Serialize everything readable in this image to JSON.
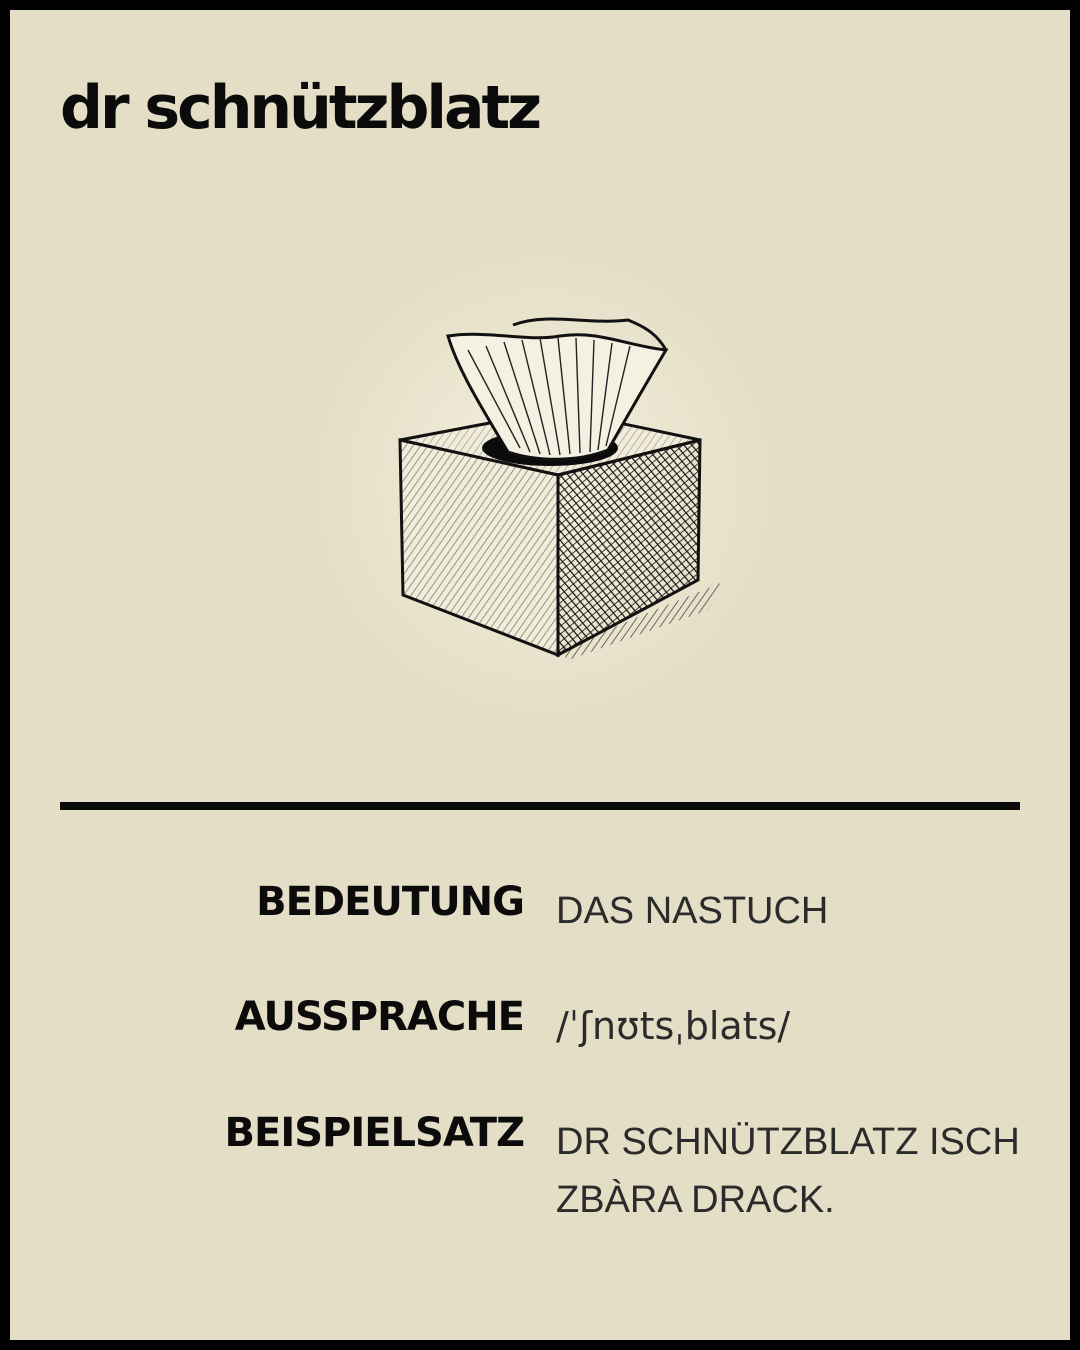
{
  "title": "dr schnützblatz",
  "image": {
    "icon": "tissue-box-icon"
  },
  "entries": [
    {
      "label": "Bedeutung",
      "value": "Das Nastuch"
    },
    {
      "label": "Aussprache",
      "value": "/ˈʃnʊtsˌblats/"
    },
    {
      "label": "Beispielsatz",
      "value": "Dr Schnützblatz isch zbàra drack."
    }
  ],
  "colors": {
    "background": "#e4dec6",
    "frame": "#000000",
    "text": "#0b0b0b",
    "value_text": "#2b2b2b"
  }
}
